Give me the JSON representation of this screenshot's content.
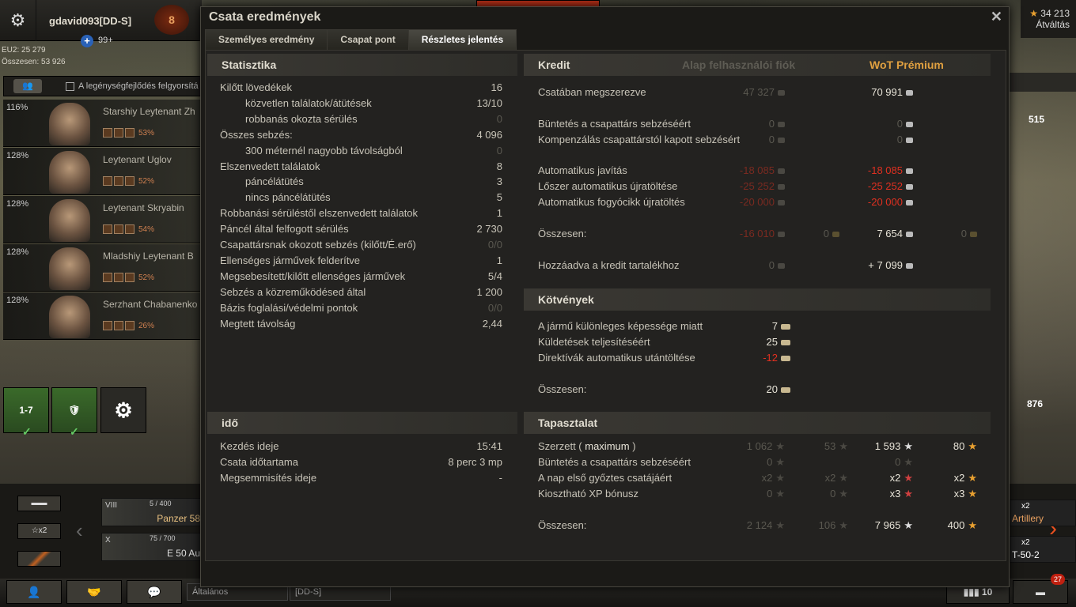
{
  "top": {
    "username": "gdavid093[DD-S]",
    "level": "8",
    "plus_count": "99+",
    "eu": "EU2: 25 279",
    "total": "Összesen: 53 926",
    "gold": "34 213",
    "exchange": "Átváltás"
  },
  "crew": {
    "header_text": "A legénységfejlődés felgyorsítá",
    "members": [
      {
        "pct": "116%",
        "name": "Starshiy Leytenant Zh",
        "skill": "53%"
      },
      {
        "pct": "128%",
        "name": "Leytenant Uglov",
        "skill": "52%"
      },
      {
        "pct": "128%",
        "name": "Leytenant Skryabin",
        "skill": "54%"
      },
      {
        "pct": "128%",
        "name": "Mladshiy Leytenant B",
        "skill": "52%"
      },
      {
        "pct": "128%",
        "name": "Serzhant Chabanenko",
        "skill": "26%"
      }
    ]
  },
  "platoon": {
    "tier_label": "1-7"
  },
  "carousel": {
    "x2": "x2",
    "tanks": [
      {
        "tier": "VIII",
        "xp": "5 / 400",
        "name": "Panzer 58"
      },
      {
        "tier": "X",
        "xp": "75 / 700",
        "name": "E 50 Au"
      }
    ],
    "right": [
      {
        "x": "x2",
        "name": "Artillery"
      },
      {
        "x": "x2",
        "name": "T-50-2"
      }
    ]
  },
  "bottom": {
    "channel1": "Általános",
    "channel2": "[DD-S]",
    "count": "10",
    "badge": "27"
  },
  "right": {
    "n1": "515",
    "n2": "876"
  },
  "modal": {
    "title": "Csata eredmények",
    "close": "✕",
    "tabs": [
      "Személyes eredmény",
      "Csapat pont",
      "Részletes jelentés"
    ],
    "stats": {
      "heading": "Statisztika",
      "rows": [
        {
          "label": "Kilőtt lövedékek",
          "value": "16",
          "indent": false,
          "dim": false
        },
        {
          "label": "közvetlen találatok/átütések",
          "value": "13/10",
          "indent": true,
          "dim": false
        },
        {
          "label": "robbanás okozta sérülés",
          "value": "0",
          "indent": true,
          "dim": true
        },
        {
          "label": "Összes sebzés:",
          "value": "4 096",
          "indent": false,
          "dim": false
        },
        {
          "label": "300 méternél nagyobb távolságból",
          "value": "0",
          "indent": true,
          "dim": true
        },
        {
          "label": "Elszenvedett találatok",
          "value": "8",
          "indent": false,
          "dim": false
        },
        {
          "label": "páncélátütés",
          "value": "3",
          "indent": true,
          "dim": false
        },
        {
          "label": "nincs páncélátütés",
          "value": "5",
          "indent": true,
          "dim": false
        },
        {
          "label": "Robbanási sérüléstől elszenvedett találatok",
          "value": "1",
          "indent": false,
          "dim": false
        },
        {
          "label": "Páncél által felfogott sérülés",
          "value": "2 730",
          "indent": false,
          "dim": false
        },
        {
          "label": "Csapattársnak okozott sebzés (kilőtt/É.erő)",
          "value": "0/0",
          "indent": false,
          "dim": true
        },
        {
          "label": "Ellenséges járművek felderítve",
          "value": "1",
          "indent": false,
          "dim": false
        },
        {
          "label": "Megsebesített/kilőtt ellenséges járművek",
          "value": "5/4",
          "indent": false,
          "dim": false
        },
        {
          "label": "Sebzés a közreműködésed által",
          "value": "1 200",
          "indent": false,
          "dim": false
        },
        {
          "label": "Bázis foglalási/védelmi pontok",
          "value": "0/0",
          "indent": false,
          "dim": true
        },
        {
          "label": "Megtett távolság",
          "value": "2,44",
          "indent": false,
          "dim": false
        }
      ]
    },
    "time": {
      "heading": "idő",
      "rows": [
        {
          "label": "Kezdés ideje",
          "value": "15:41"
        },
        {
          "label": "Csata időtartama",
          "value": "8 perc 3 mp"
        },
        {
          "label": "Megsemmisítés ideje",
          "value": "-"
        }
      ]
    },
    "credit": {
      "heading": "Kredit",
      "col_basic": "Alap felhasználói fiók",
      "col_premium": "WoT Prémium",
      "earned": {
        "label": "Csatában megszerezve",
        "basic": "47 327",
        "premium": "70 991"
      },
      "penalty": {
        "label": "Büntetés a csapattárs sebzéséért",
        "basic": "0",
        "premium": "0"
      },
      "comp": {
        "label": "Kompenzálás csapattárstól kapott sebzésért",
        "basic": "0",
        "premium": "0"
      },
      "repair": {
        "label": "Automatikus javítás",
        "basic": "-18 085",
        "premium": "-18 085"
      },
      "ammo": {
        "label": "Lőszer automatikus újratöltése",
        "basic": "-25 252",
        "premium": "-25 252"
      },
      "cons": {
        "label": "Automatikus fogyócikk újratöltés",
        "basic": "-20 000",
        "premium": "-20 000"
      },
      "total": {
        "label": "Összesen:",
        "basic": "-16 010",
        "basic_gold": "0",
        "premium": "7 654",
        "premium_gold": "0"
      },
      "reserve": {
        "label": "Hozzáadva a kredit tartalékhoz",
        "basic": "0",
        "premium": "+ 7 099"
      }
    },
    "bonds": {
      "heading": "Kötvények",
      "rows": [
        {
          "label": "A jármű különleges képessége miatt",
          "value": "7",
          "red": false
        },
        {
          "label": "Küldetések teljesítéséért",
          "value": "25",
          "red": false
        },
        {
          "label": "Direktívák automatikus utántöltése",
          "value": "-12",
          "red": true
        }
      ],
      "total": {
        "label": "Összesen:",
        "value": "20"
      }
    },
    "xp": {
      "heading": "Tapasztalat",
      "earned": {
        "label": "Szerzett (",
        "label_max": "maximum",
        "label_end": ")",
        "b1": "1 062",
        "b2": "53",
        "p1": "1 593",
        "p2": "80"
      },
      "penalty": {
        "label": "Büntetés a csapattárs sebzéséért",
        "b1": "0",
        "p1": "0"
      },
      "first": {
        "label": "A nap első győztes csatájáért",
        "b1": "x2",
        "b2": "x2",
        "p1": "x2",
        "p2": "x2"
      },
      "bonus": {
        "label": "Kiosztható XP bónusz",
        "b1": "0",
        "b2": "0",
        "p1": "x3",
        "p2": "x3"
      },
      "total": {
        "label": "Összesen:",
        "b1": "2 124",
        "b2": "106",
        "p1": "7 965",
        "p2": "400"
      }
    }
  }
}
